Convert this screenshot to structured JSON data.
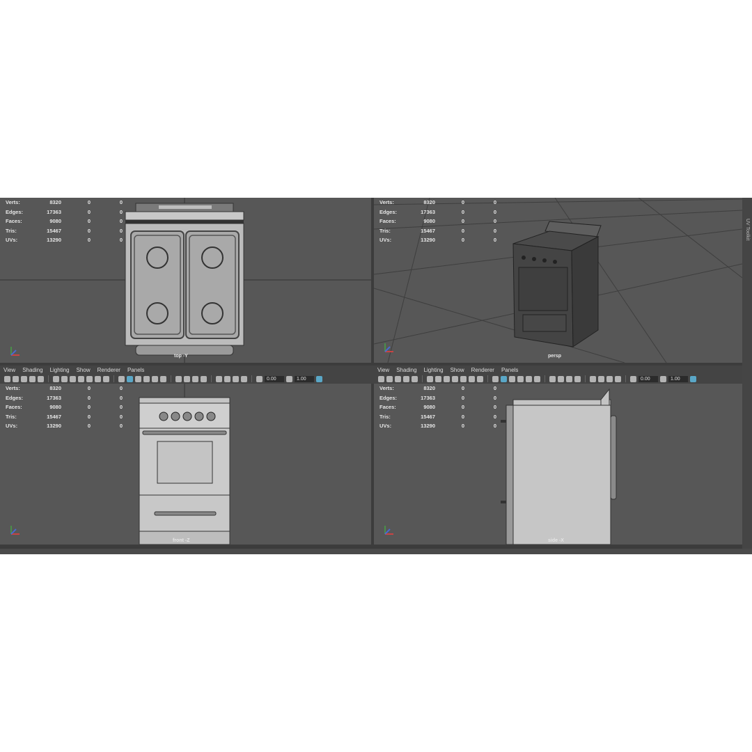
{
  "stats": [
    {
      "label": "Verts:",
      "v1": "8320",
      "v2": "0",
      "v3": "0"
    },
    {
      "label": "Edges:",
      "v1": "17363",
      "v2": "0",
      "v3": "0"
    },
    {
      "label": "Faces:",
      "v1": "9080",
      "v2": "0",
      "v3": "0"
    },
    {
      "label": "Tris:",
      "v1": "15467",
      "v2": "0",
      "v3": "0"
    },
    {
      "label": "UVs:",
      "v1": "13290",
      "v2": "0",
      "v3": "0"
    }
  ],
  "viewports": {
    "top": {
      "camera": "top -Y"
    },
    "persp": {
      "camera": "persp"
    },
    "front": {
      "camera": "front -Z"
    },
    "side": {
      "camera": "side -X"
    }
  },
  "menu": [
    "View",
    "Shading",
    "Lighting",
    "Show",
    "Renderer",
    "Panels"
  ],
  "toolbar": {
    "field1": "0.00",
    "field2": "1.00"
  },
  "side_panel": {
    "label": "UV Toolkit"
  },
  "colors": {
    "viewport_bg": "#575757",
    "highlight": "#5aa7c7"
  }
}
